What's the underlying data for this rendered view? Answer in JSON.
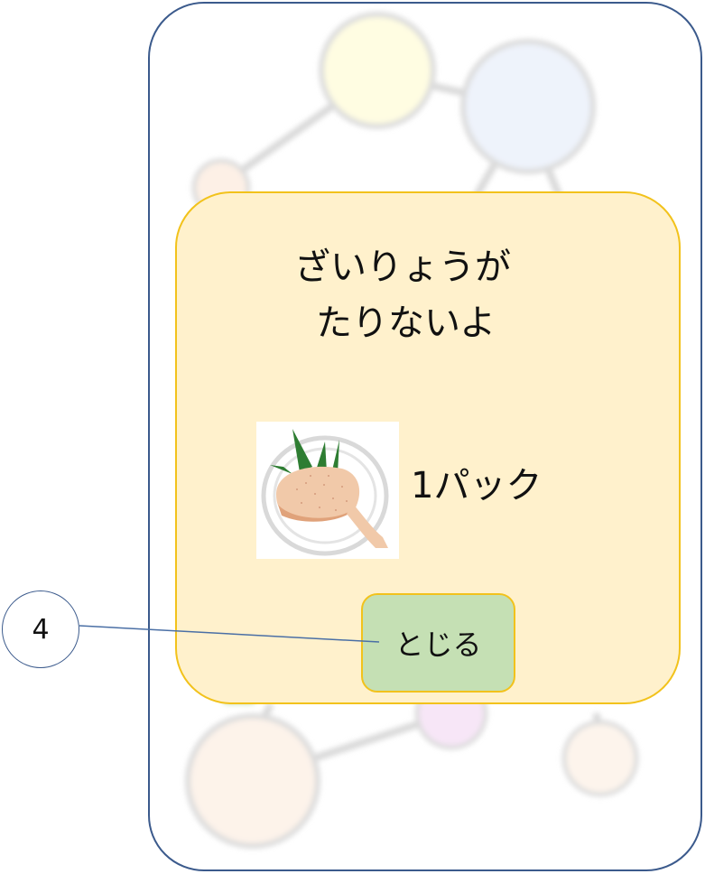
{
  "dialog": {
    "title_line1": "ざいりょうが",
    "title_line2": "たりないよ",
    "item": {
      "icon": "chicken-drumstick-on-plate-icon",
      "quantity": "1パック"
    },
    "close_label": "とじる"
  },
  "annotation": {
    "number": "4"
  },
  "colors": {
    "frame_border": "#3b5a8c",
    "dialog_fill": "#fff1cc",
    "dialog_border": "#f2c21b",
    "button_fill": "#c5e0b4"
  }
}
